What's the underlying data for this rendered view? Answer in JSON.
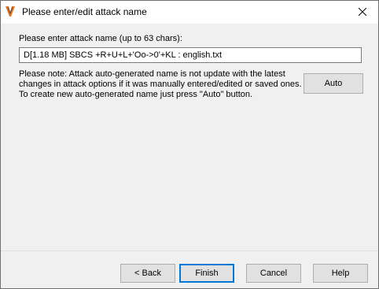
{
  "window": {
    "title": "Please enter/edit attack name"
  },
  "form": {
    "label": "Please enter attack name (up to 63 chars):",
    "name_value": "D[1.18 MB]  SBCS +R+U+L+'Oo->0'+KL : english.txt"
  },
  "note": {
    "lines": [
      "Please note: Attack auto-generated name is not update with the latest",
      "changes in attack options if it was manually entered/edited or saved ones.",
      "To create new auto-generated name just press \"Auto\" button."
    ]
  },
  "buttons": {
    "auto": "Auto",
    "back": "< Back",
    "finish": "Finish",
    "cancel": "Cancel",
    "help": "Help"
  },
  "icons": {
    "app": "app-logo-icon",
    "close": "close-icon"
  },
  "colors": {
    "default_button_border": "#0078d7",
    "logo_primary": "#e87722",
    "logo_secondary": "#4a4a4a"
  }
}
